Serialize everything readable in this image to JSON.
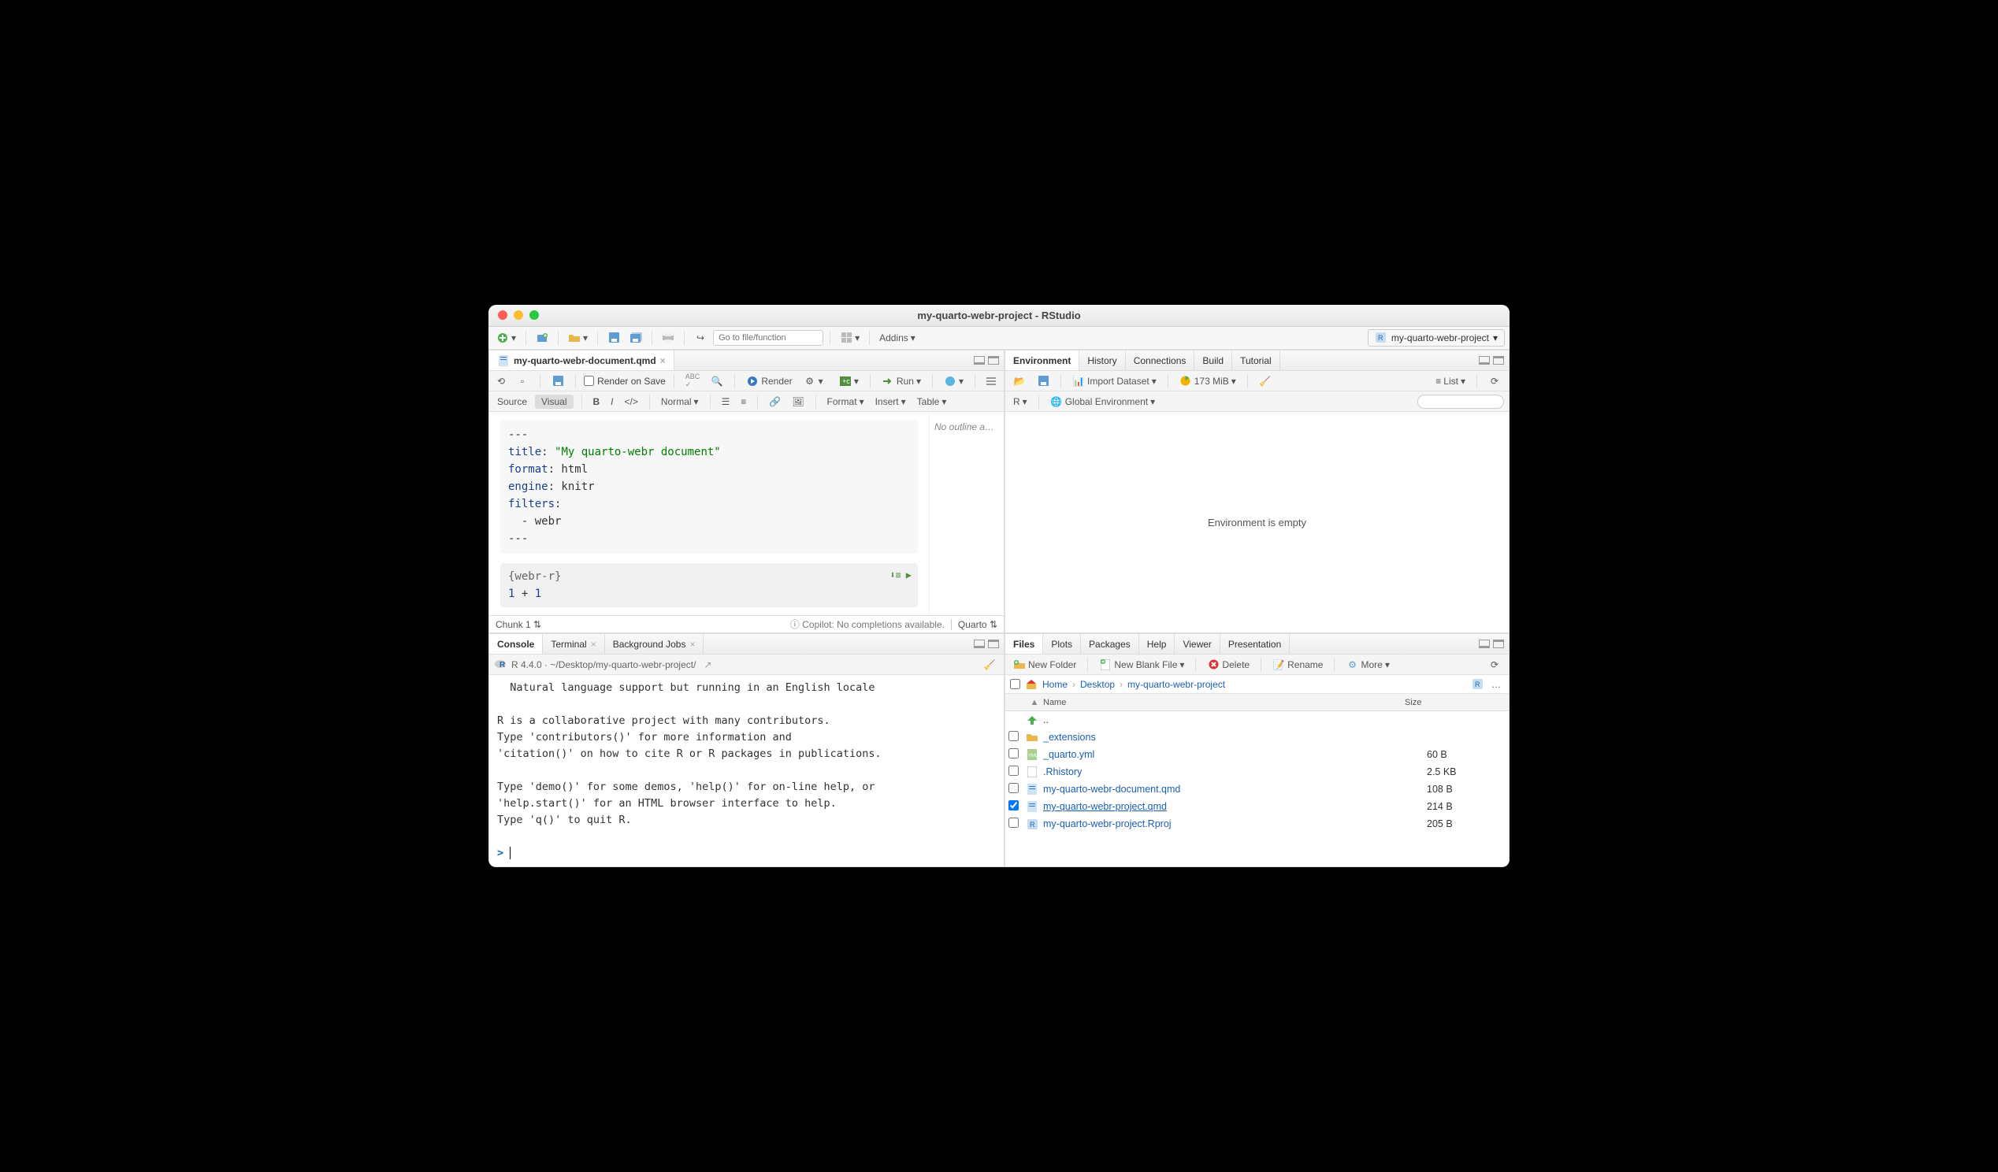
{
  "window_title": "my-quarto-webr-project - RStudio",
  "toolbar": {
    "goto_placeholder": "Go to file/function",
    "addins": "Addins",
    "project_name": "my-quarto-webr-project"
  },
  "source": {
    "tab_title": "my-quarto-webr-document.qmd",
    "render_on_save": "Render on Save",
    "render_btn": "Render",
    "run_btn": "Run",
    "view_source": "Source",
    "view_visual": "Visual",
    "format_dd": "Normal",
    "format_menu": "Format",
    "insert_menu": "Insert",
    "table_menu": "Table",
    "yaml_lines": [
      "---",
      "title: \"My quarto-webr document\"",
      "format: html",
      "engine: knitr",
      "filters:",
      "  - webr",
      "---"
    ],
    "chunk_header": "{webr-r}",
    "chunk_code": "1 + 1",
    "outline_text": "No outline a…",
    "status_left": "Chunk 1",
    "status_copilot": "Copilot: No completions available.",
    "status_lang": "Quarto"
  },
  "console": {
    "tabs": [
      "Console",
      "Terminal",
      "Background Jobs"
    ],
    "header": "R 4.4.0 · ~/Desktop/my-quarto-webr-project/",
    "body": "  Natural language support but running in an English locale\n\nR is a collaborative project with many contributors.\nType 'contributors()' for more information and\n'citation()' on how to cite R or R packages in publications.\n\nType 'demo()' for some demos, 'help()' for on-line help, or\n'help.start()' for an HTML browser interface to help.\nType 'q()' to quit R.\n\n"
  },
  "env": {
    "tabs": [
      "Environment",
      "History",
      "Connections",
      "Build",
      "Tutorial"
    ],
    "import": "Import Dataset",
    "memory": "173 MiB",
    "view": "List",
    "scope_r": "R",
    "scope_env": "Global Environment",
    "empty_msg": "Environment is empty"
  },
  "files": {
    "tabs": [
      "Files",
      "Plots",
      "Packages",
      "Help",
      "Viewer",
      "Presentation"
    ],
    "btn_newfolder": "New Folder",
    "btn_newfile": "New Blank File",
    "btn_delete": "Delete",
    "btn_rename": "Rename",
    "btn_more": "More",
    "crumbs": [
      "Home",
      "Desktop",
      "my-quarto-webr-project"
    ],
    "col_name": "Name",
    "col_size": "Size",
    "rows": [
      {
        "icon": "up",
        "name": "..",
        "size": "",
        "link": false
      },
      {
        "icon": "folder",
        "name": "_extensions",
        "size": "",
        "link": true
      },
      {
        "icon": "yml",
        "name": "_quarto.yml",
        "size": "60 B",
        "link": true
      },
      {
        "icon": "file",
        "name": ".Rhistory",
        "size": "2.5 KB",
        "link": true
      },
      {
        "icon": "qmd",
        "name": "my-quarto-webr-document.qmd",
        "size": "108 B",
        "link": true
      },
      {
        "icon": "qmd",
        "name": "my-quarto-webr-project.qmd",
        "size": "214 B",
        "link": true,
        "checked": true,
        "underline": true
      },
      {
        "icon": "rproj",
        "name": "my-quarto-webr-project.Rproj",
        "size": "205 B",
        "link": true
      }
    ]
  }
}
